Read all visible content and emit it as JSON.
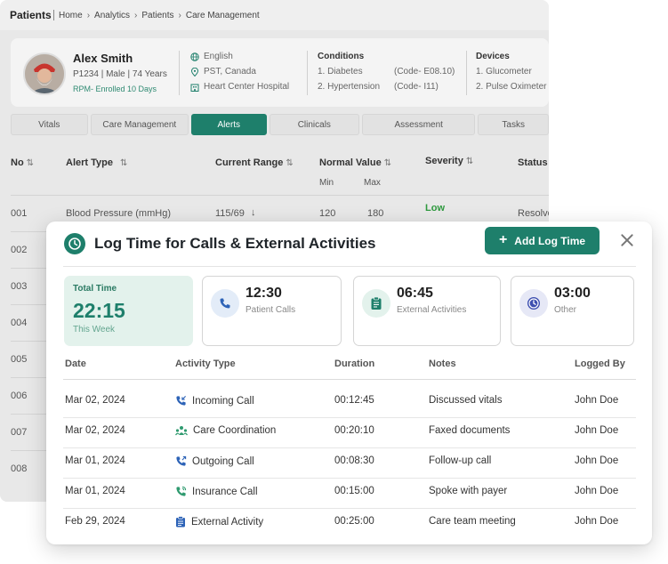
{
  "app": {
    "title": "Patients",
    "breadcrumb": [
      "Home",
      "Analytics",
      "Patients",
      "Care Management"
    ]
  },
  "patient": {
    "name": "Alex Smith",
    "info": "P1234 | Male | 74 Years",
    "rpm": "RPM- Enrolled 10 Days",
    "language": "English",
    "timezone": "PST, Canada",
    "hospital": "Heart Center Hospital",
    "conditions_label": "Conditions",
    "conditions": [
      {
        "name": "1. Diabetes",
        "code": "(Code- E08.10)"
      },
      {
        "name": "2. Hypertension",
        "code": "(Code- I11)"
      }
    ],
    "devices_label": "Devices",
    "devices": [
      "1. Glucometer",
      "2. Pulse Oximeter"
    ]
  },
  "tabs": [
    {
      "label": "Vitals"
    },
    {
      "label": "Care Management"
    },
    {
      "label": "Alerts",
      "active": true
    },
    {
      "label": "Clinicals"
    },
    {
      "label": "Assessment"
    },
    {
      "label": "Tasks"
    }
  ],
  "alerts_table": {
    "headers": {
      "no": "No",
      "type": "Alert Type",
      "range": "Current Range",
      "normal": "Normal Value",
      "min": "Min",
      "max": "Max",
      "severity": "Severity",
      "status": "Status"
    },
    "first_row": {
      "no": "001",
      "type": "Blood Pressure (mmHg)",
      "range": "115/69",
      "range_trend": "↓",
      "min": "120",
      "max": "180",
      "severity": "Low",
      "status": "Resolve"
    },
    "numbers": [
      "002",
      "003",
      "004",
      "005",
      "006",
      "007",
      "008"
    ]
  },
  "modal": {
    "title": "Log Time for Calls & External Activities",
    "add_button": "Add Log Time",
    "total": {
      "label": "Total Time",
      "value": "22:15",
      "sub": "This Week"
    },
    "summary": [
      {
        "value": "12:30",
        "label": "Patient Calls",
        "icon": "phone-icon",
        "icon_bg": "#e3ecf8",
        "icon_color": "#2d63b7"
      },
      {
        "value": "06:45",
        "label": "External Activities",
        "icon": "clipboard-icon",
        "icon_bg": "#e3f2ec",
        "icon_color": "#1e7f6b"
      },
      {
        "value": "03:00",
        "label": "Other",
        "icon": "clock-icon",
        "icon_bg": "#e6e8f6",
        "icon_color": "#3d4fb0"
      }
    ],
    "columns": {
      "date": "Date",
      "activity": "Activity Type",
      "duration": "Duration",
      "notes": "Notes",
      "logged_by": "Logged By"
    },
    "rows": [
      {
        "date": "Mar 02, 2024",
        "activity": "Incoming Call",
        "icon": "incoming-call-icon",
        "duration": "00:12:45",
        "notes": "Discussed vitals",
        "logged_by": "John Doe"
      },
      {
        "date": "Mar 02, 2024",
        "activity": "Care Coordination",
        "icon": "care-coordination-icon",
        "duration": "00:20:10",
        "notes": "Faxed documents",
        "logged_by": "John Doe"
      },
      {
        "date": "Mar 01, 2024",
        "activity": "Outgoing Call",
        "icon": "outgoing-call-icon",
        "duration": "00:08:30",
        "notes": "Follow-up call",
        "logged_by": "John Doe"
      },
      {
        "date": "Mar 01, 2024",
        "activity": "Insurance Call",
        "icon": "insurance-call-icon",
        "duration": "00:15:00",
        "notes": "Spoke with payer",
        "logged_by": "John Doe"
      },
      {
        "date": "Feb 29, 2024",
        "activity": "External Activity",
        "icon": "external-activity-icon",
        "duration": "00:25:00",
        "notes": "Care team meeting",
        "logged_by": "John Doe"
      }
    ]
  },
  "colors": {
    "brand": "#1e7f6b",
    "severity_low": "#2f9a3f"
  }
}
